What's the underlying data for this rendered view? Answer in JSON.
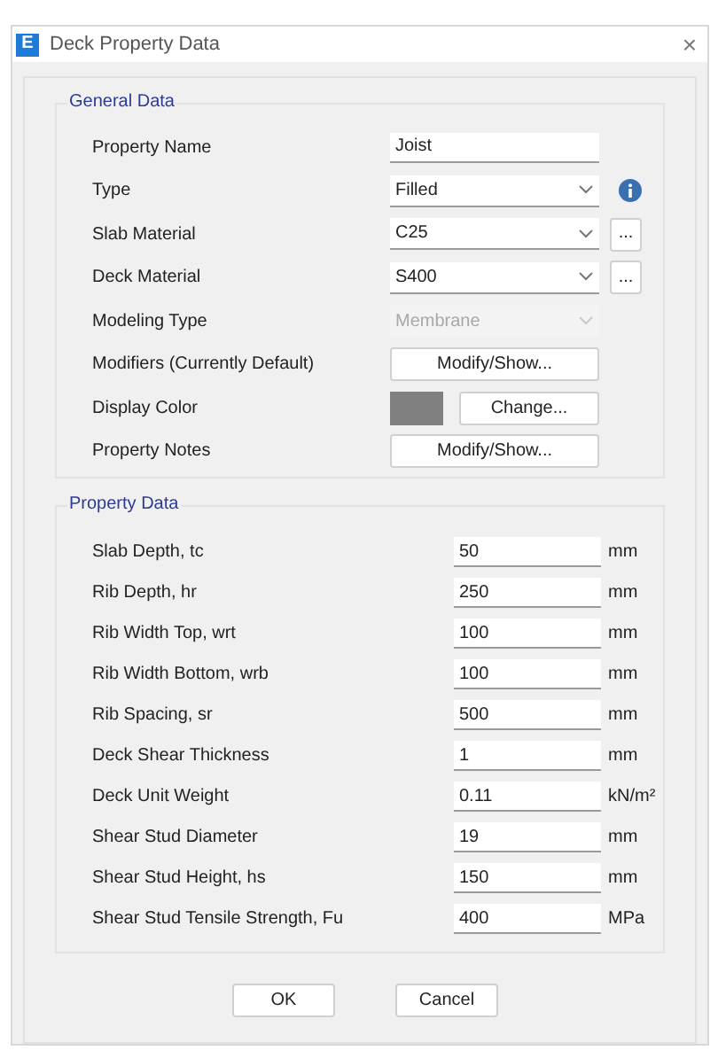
{
  "window": {
    "icon_letter": "E",
    "title": "Deck Property Data",
    "close": "×"
  },
  "general_data": {
    "title": "General Data",
    "rows": [
      {
        "label": "Property Name",
        "kind": "text",
        "value": "Joist"
      },
      {
        "label": "Type",
        "kind": "dropdown",
        "value": "Filled",
        "disabled": false,
        "info": true,
        "browse": null
      },
      {
        "label": "Slab Material",
        "kind": "dropdown",
        "value": "C25",
        "disabled": false,
        "info": false,
        "browse": "..."
      },
      {
        "label": "Deck Material",
        "kind": "dropdown",
        "value": "S400",
        "disabled": false,
        "info": false,
        "browse": "..."
      },
      {
        "label": "Modeling Type",
        "kind": "dropdown",
        "value": "Membrane",
        "disabled": true,
        "info": false,
        "browse": null
      },
      {
        "label": "Modifiers (Currently Default)",
        "kind": "button",
        "button": "Modify/Show..."
      },
      {
        "label": "Display Color",
        "kind": "color",
        "color": "#808080",
        "button": "Change..."
      },
      {
        "label": "Property Notes",
        "kind": "button",
        "button": "Modify/Show..."
      }
    ]
  },
  "property_data": {
    "title": "Property Data",
    "rows": [
      {
        "label": "Slab Depth, tc",
        "value": "50",
        "unit": "mm"
      },
      {
        "label": "Rib Depth, hr",
        "value": "250",
        "unit": "mm"
      },
      {
        "label": "Rib Width Top, wrt",
        "value": "100",
        "unit": "mm"
      },
      {
        "label": "Rib Width Bottom, wrb",
        "value": "100",
        "unit": "mm"
      },
      {
        "label": "Rib Spacing, sr",
        "value": "500",
        "unit": "mm"
      },
      {
        "label": "Deck Shear Thickness",
        "value": "1",
        "unit": "mm"
      },
      {
        "label": "Deck Unit Weight",
        "value": "0.11",
        "unit": "kN/m²"
      },
      {
        "label": "Shear Stud Diameter",
        "value": "19",
        "unit": "mm"
      },
      {
        "label": "Shear Stud Height, hs",
        "value": "150",
        "unit": "mm"
      },
      {
        "label": "Shear Stud Tensile Strength, Fu",
        "value": "400",
        "unit": "MPa"
      }
    ]
  },
  "buttons": [
    "OK",
    "Cancel"
  ]
}
